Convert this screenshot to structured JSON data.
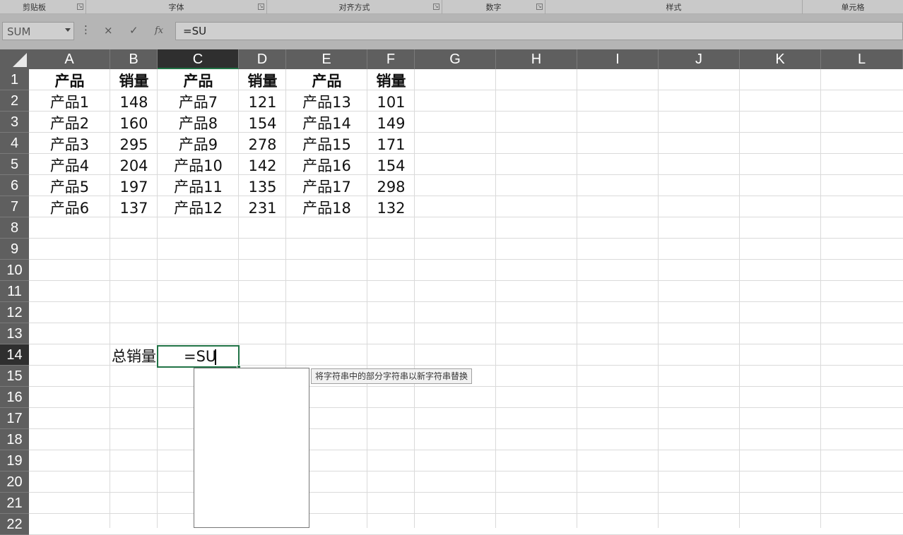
{
  "ribbon": {
    "groups": [
      {
        "label": "剪贴板",
        "launcher": true
      },
      {
        "label": "字体",
        "launcher": true
      },
      {
        "label": "对齐方式",
        "launcher": true
      },
      {
        "label": "数字",
        "launcher": true
      },
      {
        "label": "样式",
        "launcher": false
      },
      {
        "label": "单元格",
        "launcher": false
      }
    ]
  },
  "formula_bar": {
    "name_box": "SUM",
    "more_icon": "vertical-dots-icon",
    "cancel_icon": "×",
    "enter_icon": "✓",
    "function_icon": "fx",
    "formula": "=SU"
  },
  "sheet": {
    "columns": [
      "A",
      "B",
      "C",
      "D",
      "E",
      "F",
      "G",
      "H",
      "I",
      "J",
      "K",
      "L"
    ],
    "selected_column": "C",
    "rows": [
      "1",
      "2",
      "3",
      "4",
      "5",
      "6",
      "7",
      "8",
      "9",
      "10",
      "11",
      "12",
      "13",
      "14",
      "15",
      "16",
      "17",
      "18",
      "19",
      "20",
      "21",
      "22"
    ],
    "selected_row": "14",
    "table": [
      [
        "产品",
        "销量",
        "产品",
        "销量",
        "产品",
        "销量"
      ],
      [
        "产品1",
        "148",
        "产品7",
        "121",
        "产品13",
        "101"
      ],
      [
        "产品2",
        "160",
        "产品8",
        "154",
        "产品14",
        "149"
      ],
      [
        "产品3",
        "295",
        "产品9",
        "278",
        "产品15",
        "171"
      ],
      [
        "产品4",
        "204",
        "产品10",
        "142",
        "产品16",
        "154"
      ],
      [
        "产品5",
        "197",
        "产品11",
        "135",
        "产品17",
        "298"
      ],
      [
        "产品6",
        "137",
        "产品12",
        "231",
        "产品18",
        "132"
      ]
    ],
    "total_label": "总销量",
    "active_cell_text": "=SU"
  },
  "autocomplete": {
    "tooltip": "将字符串中的部分字符串以新字符串替换"
  },
  "colors": {
    "header_bg": "#5f5f5f",
    "selected_header_bg": "#2f2f2f",
    "accent": "#217346",
    "gridline": "#dadada"
  }
}
